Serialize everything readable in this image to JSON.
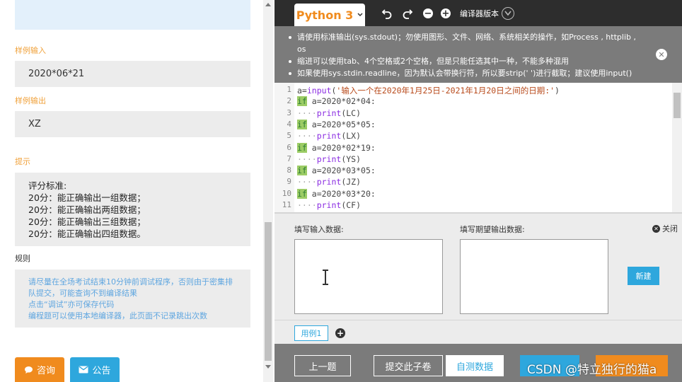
{
  "left": {
    "sample_input_label": "样例输入",
    "sample_input_value": "2020*06*21",
    "sample_output_label": "样例输出",
    "sample_output_value": "XZ",
    "hint_label": "提示",
    "hint_lines": [
      "评分标准:",
      "20分：能正确输出一组数据；",
      "20分：能正确输出两组数据；",
      "20分：能正确输出三组数据；",
      "20分：能正确输出四组数据。"
    ],
    "rules_label": "规则",
    "rules_lines": [
      "请尽量在全场考试结束10分钟前调试程序，否则由于密集排",
      "队提交，可能查询不到编译结果",
      "点击“调试”亦可保存代码",
      "编程题可以使用本地编译器，此页面不记录跳出次数"
    ],
    "consult_button": "咨询",
    "notice_button": "公告"
  },
  "toolbar": {
    "language": "Python 3",
    "compiler_version_label": "编译器版本"
  },
  "notice": {
    "lines": [
      "请使用标准输出(sys.stdout)；勿使用图形、文件、网络、系统相关的操作，如Process , httplib , os",
      "缩进可以使用tab、4个空格或2个空格，但是只能任选其中一种，不能多种混用",
      "如果使用sys.stdin.readline，因为默认会带换行符，所以要strip(' ')进行截取；建议使用input()"
    ]
  },
  "editor": {
    "lines": [
      {
        "n": "1",
        "text": "a=input('输入一个在2020年1月25日-2021年1月20日之间的日期:')"
      },
      {
        "n": "2",
        "text": "if a=2020*02*04:"
      },
      {
        "n": "3",
        "text": "····print(LC)"
      },
      {
        "n": "4",
        "text": "if a=2020*05*05:"
      },
      {
        "n": "5",
        "text": "····print(LX)"
      },
      {
        "n": "6",
        "text": "if a=2020*02*19:"
      },
      {
        "n": "7",
        "text": "····print(YS)"
      },
      {
        "n": "8",
        "text": "if a=2020*03*05:"
      },
      {
        "n": "9",
        "text": "····print(JZ)"
      },
      {
        "n": "10",
        "text": "if a=2020*03*20:"
      },
      {
        "n": "11",
        "text": "····print(CF)"
      }
    ]
  },
  "io": {
    "input_label": "填写输入数据:",
    "output_label": "填写期望输出数据:",
    "close_label": "关闭",
    "new_button": "新建",
    "case_tab": "用例1"
  },
  "bottom": {
    "prev_button": "上一题",
    "submit_section_button": "提交此子卷",
    "self_test_button": "自测数据"
  },
  "watermark": "CSDN @特立独行的猫a",
  "colors": {
    "accent_orange": "#f08b1e",
    "accent_blue": "#2ea7dd",
    "toolbar_dark": "#2d2d2d",
    "panel_gray": "#7b7b7b"
  }
}
